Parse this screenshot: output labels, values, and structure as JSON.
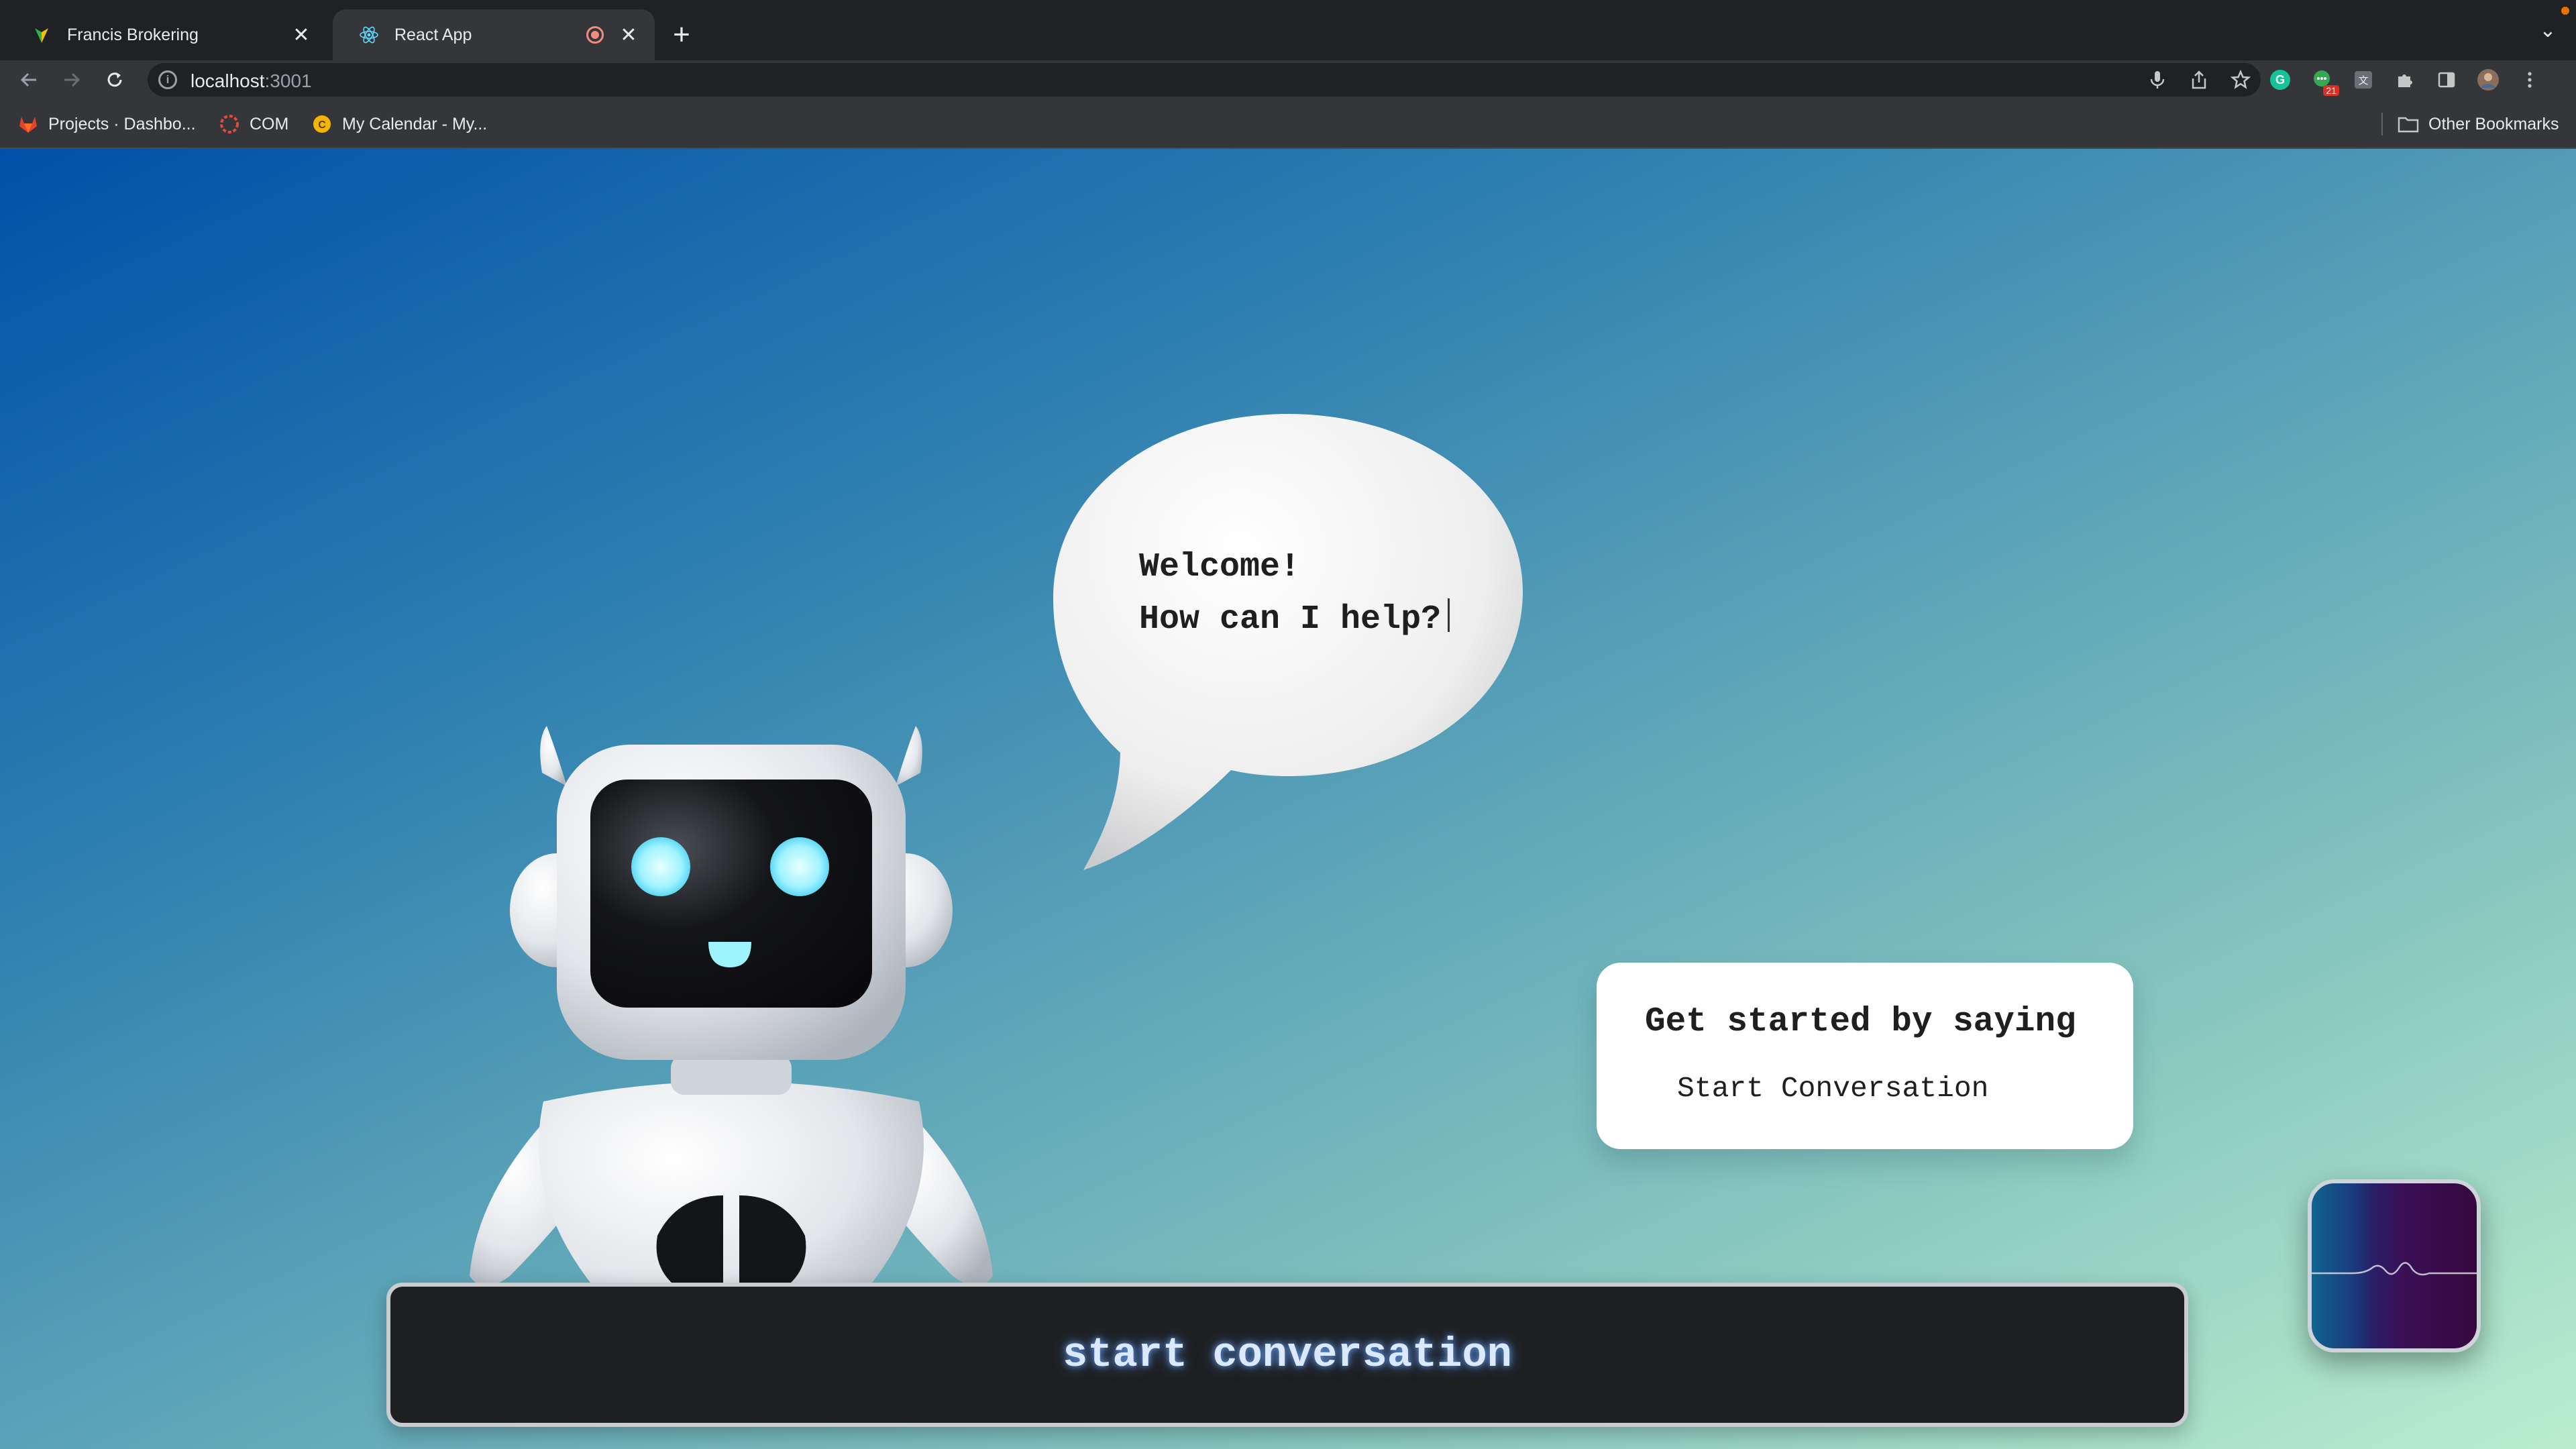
{
  "browser": {
    "tabs": [
      {
        "title": "Francis Brokering",
        "active": false,
        "favicon": "green-yellow-logo-icon"
      },
      {
        "title": "React App",
        "active": true,
        "favicon": "react-icon",
        "recording": true
      }
    ],
    "new_tab_label": "+",
    "address": {
      "host": "localhost",
      "port": ":3001"
    },
    "extension_badge": "21",
    "bookmarks": [
      {
        "label": "Projects · Dashbo...",
        "icon": "gitlab-icon"
      },
      {
        "label": "COM",
        "icon": "red-badge-icon"
      },
      {
        "label": "My Calendar - My...",
        "icon": "calendar-icon"
      }
    ],
    "other_bookmarks": "Other Bookmarks"
  },
  "page": {
    "bubble": {
      "line1": "Welcome!",
      "line2": "How can I help?"
    },
    "hint": {
      "title": "Get started by saying",
      "phrase": "Start Conversation"
    },
    "conversation_button": "start conversation",
    "colors": {
      "gradient_start": "#0051a8",
      "gradient_end": "#b9edcd",
      "button_bg": "#1e1f21",
      "button_text_glow": "#dbe9ff"
    }
  }
}
